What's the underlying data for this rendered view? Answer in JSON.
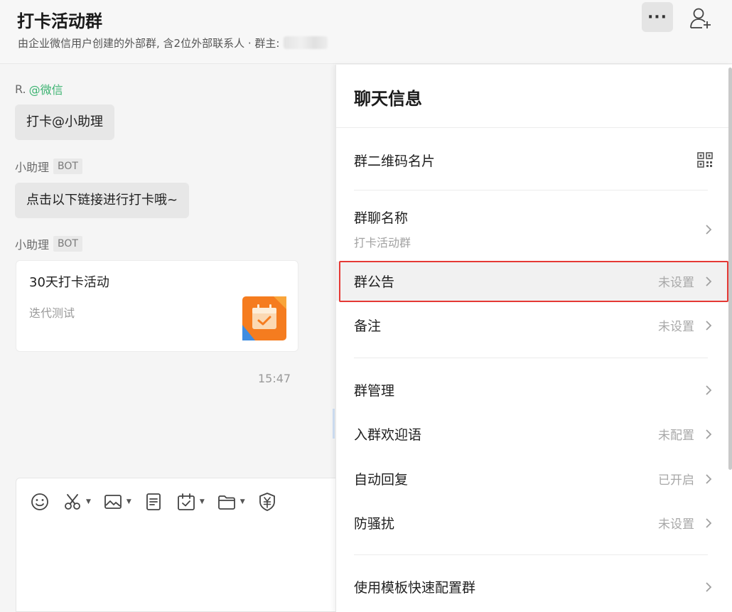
{
  "header": {
    "title": "打卡活动群",
    "subtitle": "由企业微信用户创建的外部群, 含2位外部联系人 · 群主:",
    "more_label": "···"
  },
  "chat": {
    "messages": [
      {
        "sender": "R.",
        "sender_tag": "@微信",
        "text": "打卡@小助理"
      },
      {
        "sender": "小助理",
        "badge": "BOT",
        "text": "点击以下链接进行打卡哦~"
      },
      {
        "sender": "小助理",
        "badge": "BOT",
        "card": {
          "title": "30天打卡活动",
          "desc": "迭代测试"
        }
      }
    ],
    "timestamp": "15:47"
  },
  "panel": {
    "title": "聊天信息",
    "rows": [
      {
        "label": "群二维码名片"
      },
      {
        "label": "群聊名称",
        "sublabel": "打卡活动群"
      },
      {
        "label": "群公告",
        "value": "未设置"
      },
      {
        "label": "备注",
        "value": "未设置"
      },
      {
        "label": "群管理"
      },
      {
        "label": "入群欢迎语",
        "value": "未配置"
      },
      {
        "label": "自动回复",
        "value": "已开启"
      },
      {
        "label": "防骚扰",
        "value": "未设置"
      },
      {
        "label": "使用模板快速配置群"
      }
    ]
  },
  "colors": {
    "accent_green": "#3cb371",
    "highlight_red": "#e53935",
    "card_icon_orange": "#f57c1f"
  }
}
